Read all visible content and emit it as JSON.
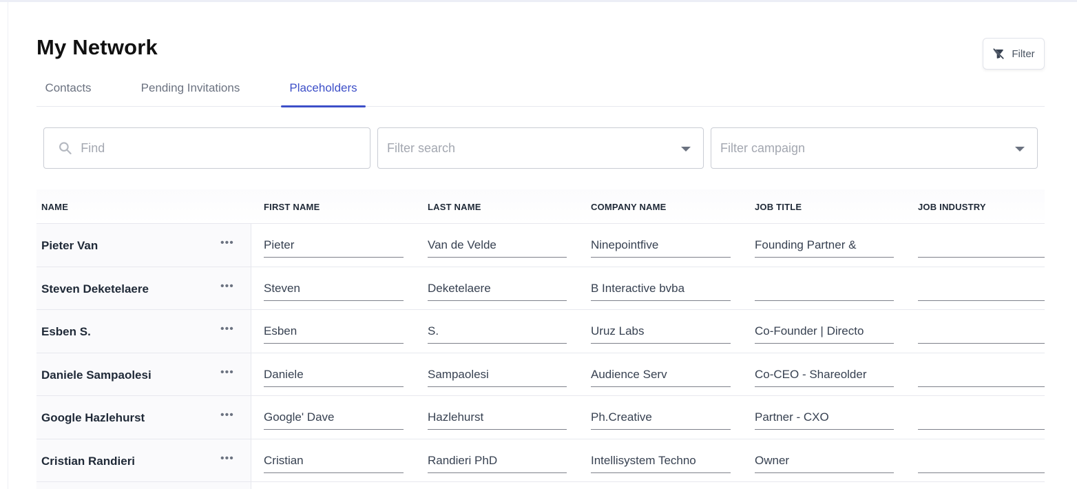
{
  "page": {
    "title": "My Network"
  },
  "filter_button": {
    "label": "Filter",
    "icon": "filter-off-icon"
  },
  "tabs": [
    {
      "label": "Contacts",
      "active": false
    },
    {
      "label": "Pending Invitations",
      "active": false
    },
    {
      "label": "Placeholders",
      "active": true
    }
  ],
  "search": {
    "placeholder": "Find",
    "value": "",
    "icon": "search-icon"
  },
  "filter_search": {
    "placeholder": "Filter search",
    "value": ""
  },
  "filter_campaign": {
    "placeholder": "Filter campaign",
    "value": ""
  },
  "table": {
    "columns": [
      "NAME",
      "FIRST NAME",
      "LAST NAME",
      "COMPANY NAME",
      "JOB TITLE",
      "JOB INDUSTRY"
    ],
    "rows": [
      {
        "name": "Pieter Van",
        "first_name": "Pieter",
        "last_name": "Van de Velde",
        "company": "Ninepointfive",
        "job_title": "Founding Partner &",
        "job_industry": ""
      },
      {
        "name": "Steven Deketelaere",
        "first_name": "Steven",
        "last_name": "Deketelaere",
        "company": "B Interactive bvba",
        "job_title": "",
        "job_industry": ""
      },
      {
        "name": "Esben S.",
        "first_name": "Esben",
        "last_name": "S.",
        "company": "Uruz Labs",
        "job_title": "Co-Founder | Directo",
        "job_industry": ""
      },
      {
        "name": "Daniele Sampaolesi",
        "first_name": "Daniele",
        "last_name": "Sampaolesi",
        "company": "Audience Serv",
        "job_title": "Co-CEO - Shareolder",
        "job_industry": ""
      },
      {
        "name": "Google Hazlehurst",
        "first_name": "Google' Dave",
        "last_name": "Hazlehurst",
        "company": "Ph.Creative",
        "job_title": "Partner - CXO",
        "job_industry": ""
      },
      {
        "name": "Cristian Randieri",
        "first_name": "Cristian",
        "last_name": "Randieri PhD",
        "company": "Intellisystem Techno",
        "job_title": "Owner",
        "job_industry": ""
      }
    ],
    "row_menu_icon": "more-horizontal-icon"
  },
  "colors": {
    "accent": "#3d4fc8",
    "text": "#1f2937",
    "muted": "#6b7280",
    "border": "#c9ccd4"
  }
}
